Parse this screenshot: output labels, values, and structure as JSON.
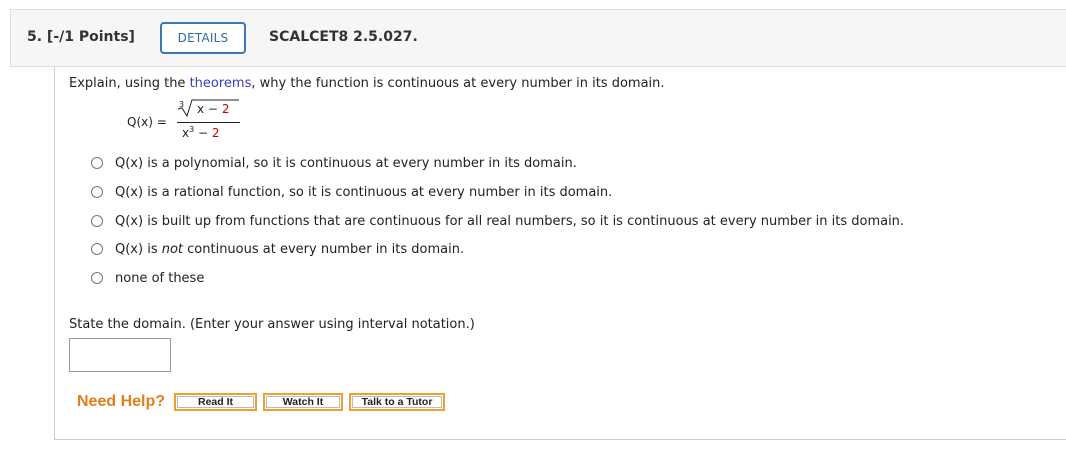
{
  "header": {
    "question_number": "5. [-/1 Points]",
    "details_label": "DETAILS",
    "code": "SCALCET8 2.5.027."
  },
  "prompt": {
    "before": "Explain, using the ",
    "link": "theorems",
    "after": ", why the function is continuous at every number in its domain."
  },
  "formula": {
    "lhs": "Q(x)  =",
    "root_index": "3",
    "numerator_var": "x −",
    "numerator_const": "2",
    "denominator_var": "x",
    "denominator_exp": "3",
    "denominator_op": "−",
    "denominator_const": "2"
  },
  "options": [
    {
      "pre": "Q(x) is a polynomial, so it is continuous at every number in its domain.",
      "em": "",
      "post": ""
    },
    {
      "pre": "Q(x) is a rational function, so it is continuous at every number in its domain.",
      "em": "",
      "post": ""
    },
    {
      "pre": "Q(x) is built up from functions that are continuous for all real numbers, so it is continuous at every number in its domain.",
      "em": "",
      "post": ""
    },
    {
      "pre": "Q(x) is ",
      "em": "not",
      "post": " continuous at every number in its domain."
    },
    {
      "pre": "none of these",
      "em": "",
      "post": ""
    }
  ],
  "domain_prompt": "State the domain. (Enter your answer using interval notation.)",
  "domain_answer": "",
  "help": {
    "label": "Need Help?",
    "buttons": [
      "Read It",
      "Watch It",
      "Talk to a Tutor"
    ]
  },
  "colors": {
    "accent_blue": "#3a78b0",
    "link": "#3b3bbf",
    "highlight_red": "#cc0000",
    "help_orange": "#e07f1c"
  }
}
